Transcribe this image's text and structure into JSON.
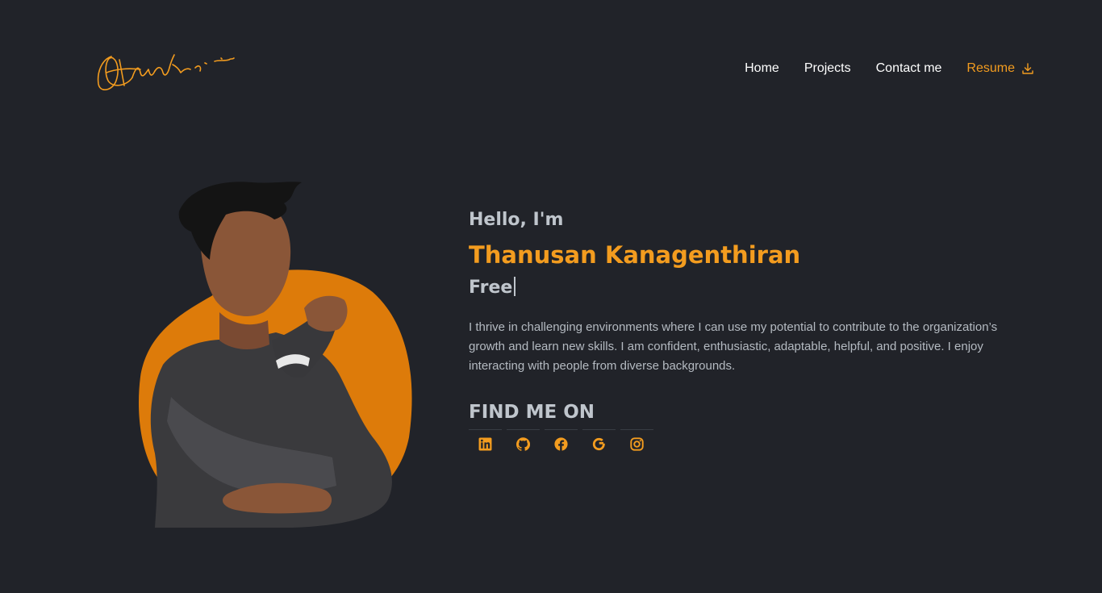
{
  "brand": {
    "logo_text": "Thusan",
    "accent_color": "#f39c1f",
    "background_color": "#212329"
  },
  "nav": {
    "items": [
      {
        "label": "Home"
      },
      {
        "label": "Projects"
      },
      {
        "label": "Contact me"
      }
    ],
    "resume": {
      "label": "Resume",
      "icon": "download-icon"
    }
  },
  "hero": {
    "greeting": "Hello, I'm",
    "name": "Thanusan Kanagenthiran",
    "typed_text": "Free",
    "bio": "I thrive in challenging environments where I can use my potential to contribute to the organization’s growth and learn new skills. I am confident, enthusiastic, adaptable, helpful, and positive. I enjoy interacting with people from diverse backgrounds.",
    "portrait_icon": "profile-photo"
  },
  "social": {
    "heading": "FIND ME ON",
    "links": [
      {
        "icon": "linkedin-icon"
      },
      {
        "icon": "github-icon"
      },
      {
        "icon": "facebook-icon"
      },
      {
        "icon": "google-icon"
      },
      {
        "icon": "instagram-icon"
      }
    ]
  }
}
